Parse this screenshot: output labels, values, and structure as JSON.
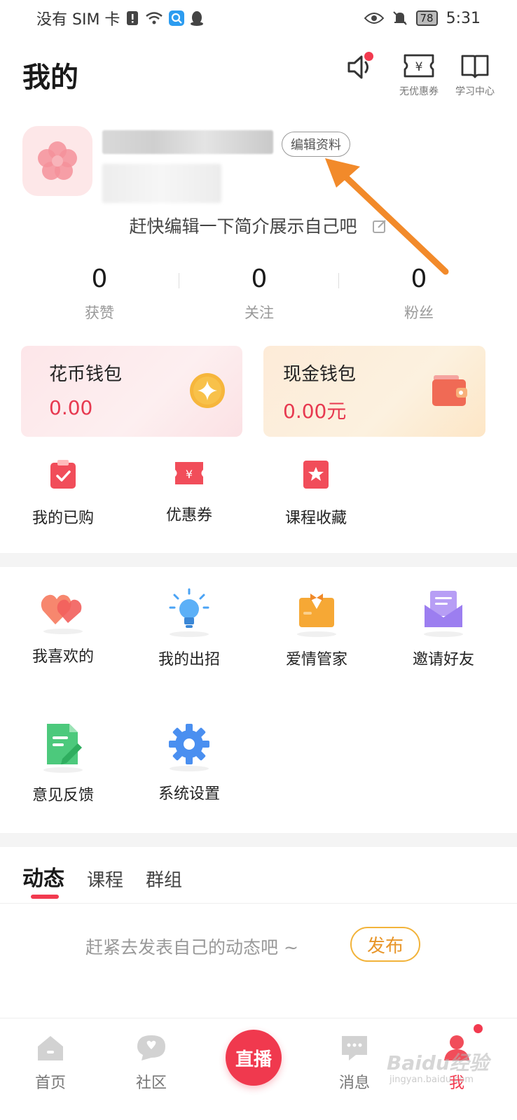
{
  "status_bar": {
    "carrier": "没有 SIM 卡",
    "battery": "78",
    "time": "5:31"
  },
  "header": {
    "title": "我的",
    "coupon_label": "无优惠券",
    "study_label": "学习中心"
  },
  "profile": {
    "edit_label": "编辑资料",
    "bio": "赶快编辑一下简介展示自己吧"
  },
  "stats": [
    {
      "value": "0",
      "label": "获赞"
    },
    {
      "value": "0",
      "label": "关注"
    },
    {
      "value": "0",
      "label": "粉丝"
    }
  ],
  "wallets": {
    "coin": {
      "title": "花币钱包",
      "amount": "0.00"
    },
    "cash": {
      "title": "现金钱包",
      "amount": "0.00元"
    }
  },
  "quick_items": [
    {
      "label": "我的已购",
      "icon": "purchased-icon"
    },
    {
      "label": "优惠券",
      "icon": "coupon-icon"
    },
    {
      "label": "课程收藏",
      "icon": "favorite-course-icon"
    }
  ],
  "grid_items": [
    {
      "label": "我喜欢的",
      "icon": "hearts-icon"
    },
    {
      "label": "我的出招",
      "icon": "lightbulb-icon"
    },
    {
      "label": "爱情管家",
      "icon": "butler-icon"
    },
    {
      "label": "邀请好友",
      "icon": "invite-mail-icon"
    },
    {
      "label": "意见反馈",
      "icon": "feedback-doc-icon"
    },
    {
      "label": "系统设置",
      "icon": "settings-gear-icon"
    }
  ],
  "tabs": [
    "动态",
    "课程",
    "群组"
  ],
  "feed": {
    "empty_message": "赶紧去发表自己的动态吧 ~",
    "publish_label": "发布"
  },
  "bottom_nav": {
    "home": "首页",
    "community": "社区",
    "live": "直播",
    "messages": "消息",
    "me": "我"
  },
  "watermark": {
    "text": "Baidu经验",
    "sub": "jingyan.baidu.com"
  },
  "colors": {
    "accent_red": "#f23a4f",
    "amount_red": "#e73950",
    "publish_orange": "#f2b33a"
  }
}
